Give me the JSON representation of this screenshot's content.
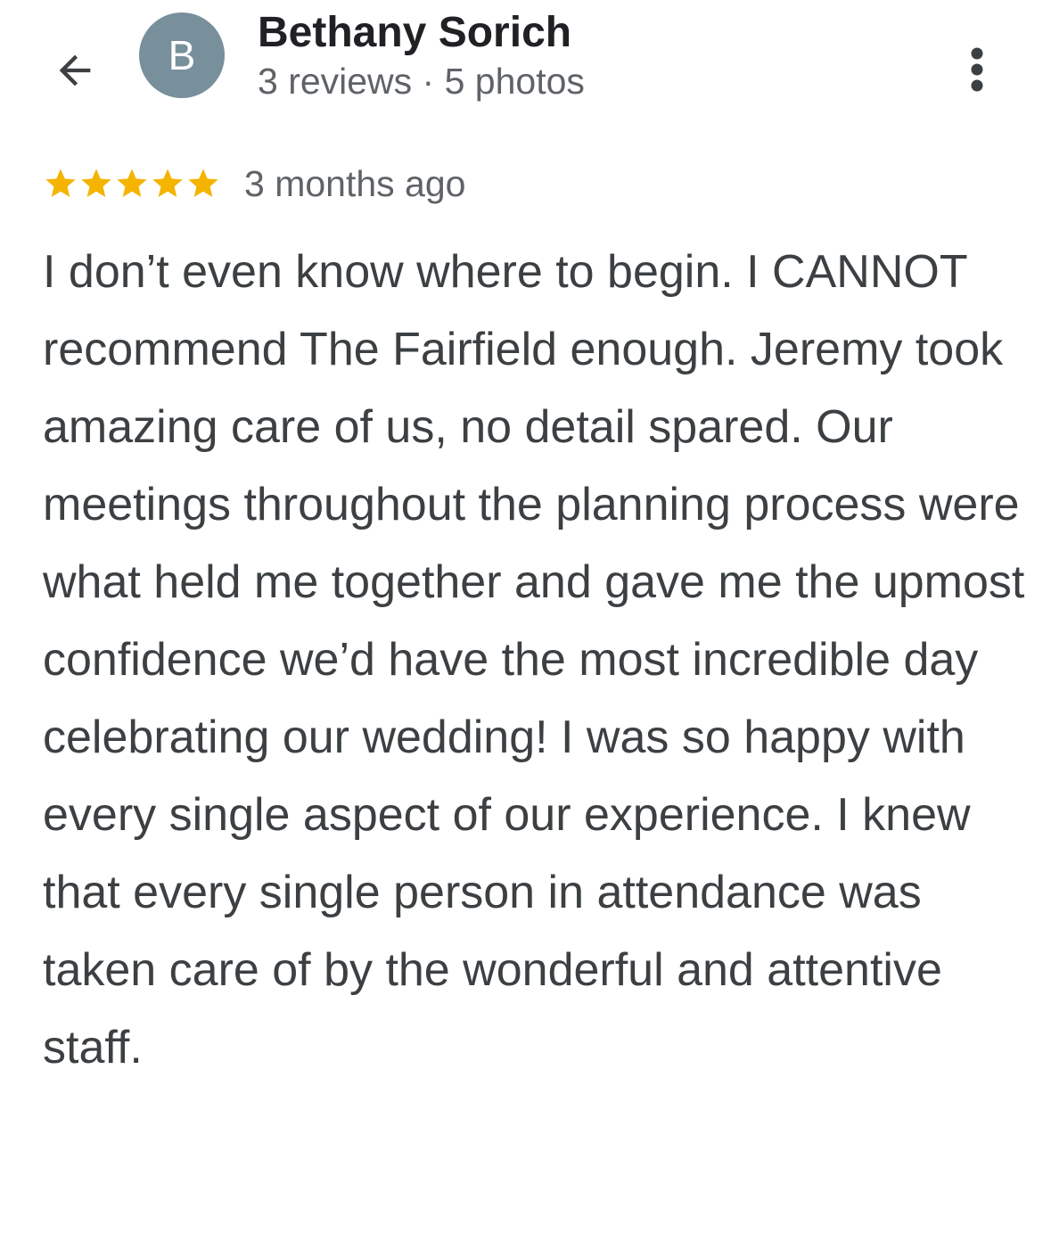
{
  "header": {
    "back_icon": "arrow-left-icon",
    "avatar_letter": "B",
    "avatar_color": "#78909c",
    "reviewer_name": "Bethany Sorich",
    "reviewer_meta": "3 reviews · 5 photos",
    "more_icon": "more-vertical-icon"
  },
  "review": {
    "rating": 5,
    "rating_max": 5,
    "star_color": "#f4b400",
    "time_ago": "3 months ago",
    "text": "I don’t even know where to begin. I CANNOT recommend The Fairfield enough. Jeremy took amazing care of us, no detail spared. Our meetings throughout the planning process were what held me together and gave me the upmost confidence we’d have the most incredible day celebrating our wedding! I was so happy with every single aspect of our experience. I knew that every single person in attendance was taken care of by the wonderful and attentive staff."
  }
}
